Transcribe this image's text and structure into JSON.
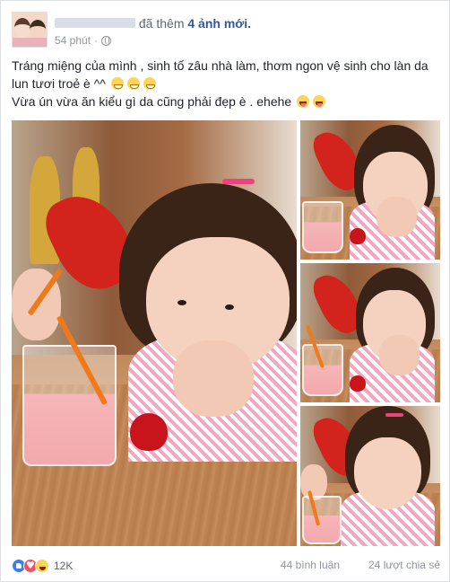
{
  "post": {
    "author_name": "",
    "action_text": "đã thêm",
    "action_link": "4 ảnh mới.",
    "timestamp": "54 phút",
    "privacy_icon": "globe-icon",
    "content_line1": "Tráng miệng của mình , sinh tố zâu nhà làm, thơm ngon vệ sinh cho làn da lun tươi troẻ è ^^",
    "content_line2": "Vừa ún vừa ăn kiểu gì da cũng phải đẹp è . ehehe",
    "content_line1_emojis": [
      "grin-emoji",
      "grin-emoji",
      "grin-emoji"
    ],
    "content_line2_emojis": [
      "tongue-emoji",
      "tongue-emoji"
    ]
  },
  "photos": [
    {
      "name": "photo-girl-drinking-main"
    },
    {
      "name": "photo-girl-smiling-1"
    },
    {
      "name": "photo-girl-smiling-2"
    },
    {
      "name": "photo-girl-smiling-3"
    }
  ],
  "footer": {
    "reaction_icons": [
      "like-icon",
      "love-icon",
      "haha-icon"
    ],
    "reaction_count": "12K",
    "comments": "44 bình luận",
    "shares": "24 lượt chia sẻ"
  },
  "colors": {
    "link": "#365899",
    "meta": "#90949c",
    "text": "#1d2129",
    "like": "#3b7bf5",
    "love": "#f25268",
    "haha": "#ffd35a"
  }
}
